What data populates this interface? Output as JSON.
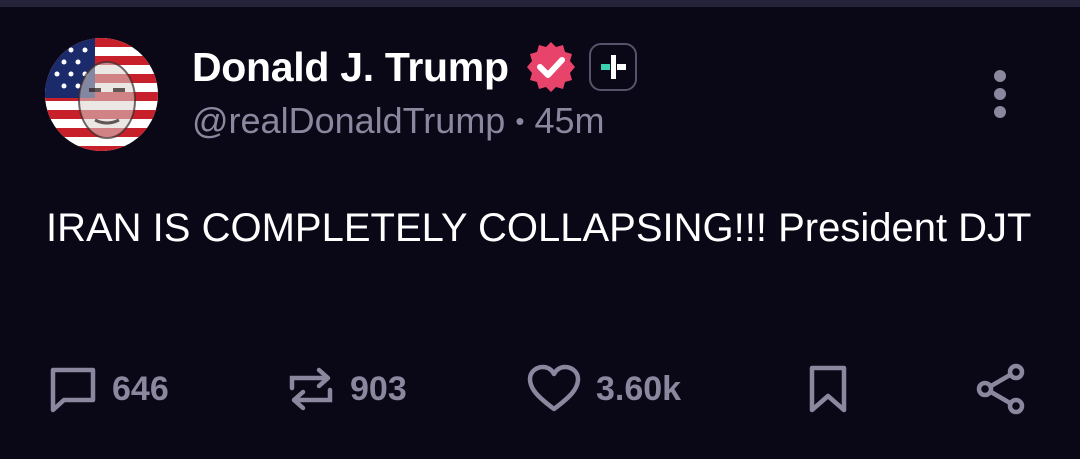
{
  "post": {
    "display_name": "Donald J. Trump",
    "handle": "@realDonaldTrump",
    "separator": "•",
    "time_ago": "45m",
    "text": "IRAN IS COMPLETELY COLLAPSING!!! President DJT"
  },
  "actions": {
    "replies": "646",
    "reposts": "903",
    "likes": "3.60k"
  },
  "colors": {
    "background": "#0a0716",
    "verified_badge": "#e8436a",
    "muted_text": "#8a879e",
    "plus_accent": "#3ad2b0"
  },
  "icons": {
    "verified": "verified-badge-icon",
    "plus": "plus-badge-icon",
    "more": "more-vertical-icon",
    "reply": "comment-icon",
    "repost": "repost-icon",
    "like": "heart-icon",
    "bookmark": "bookmark-icon",
    "share": "share-icon"
  }
}
